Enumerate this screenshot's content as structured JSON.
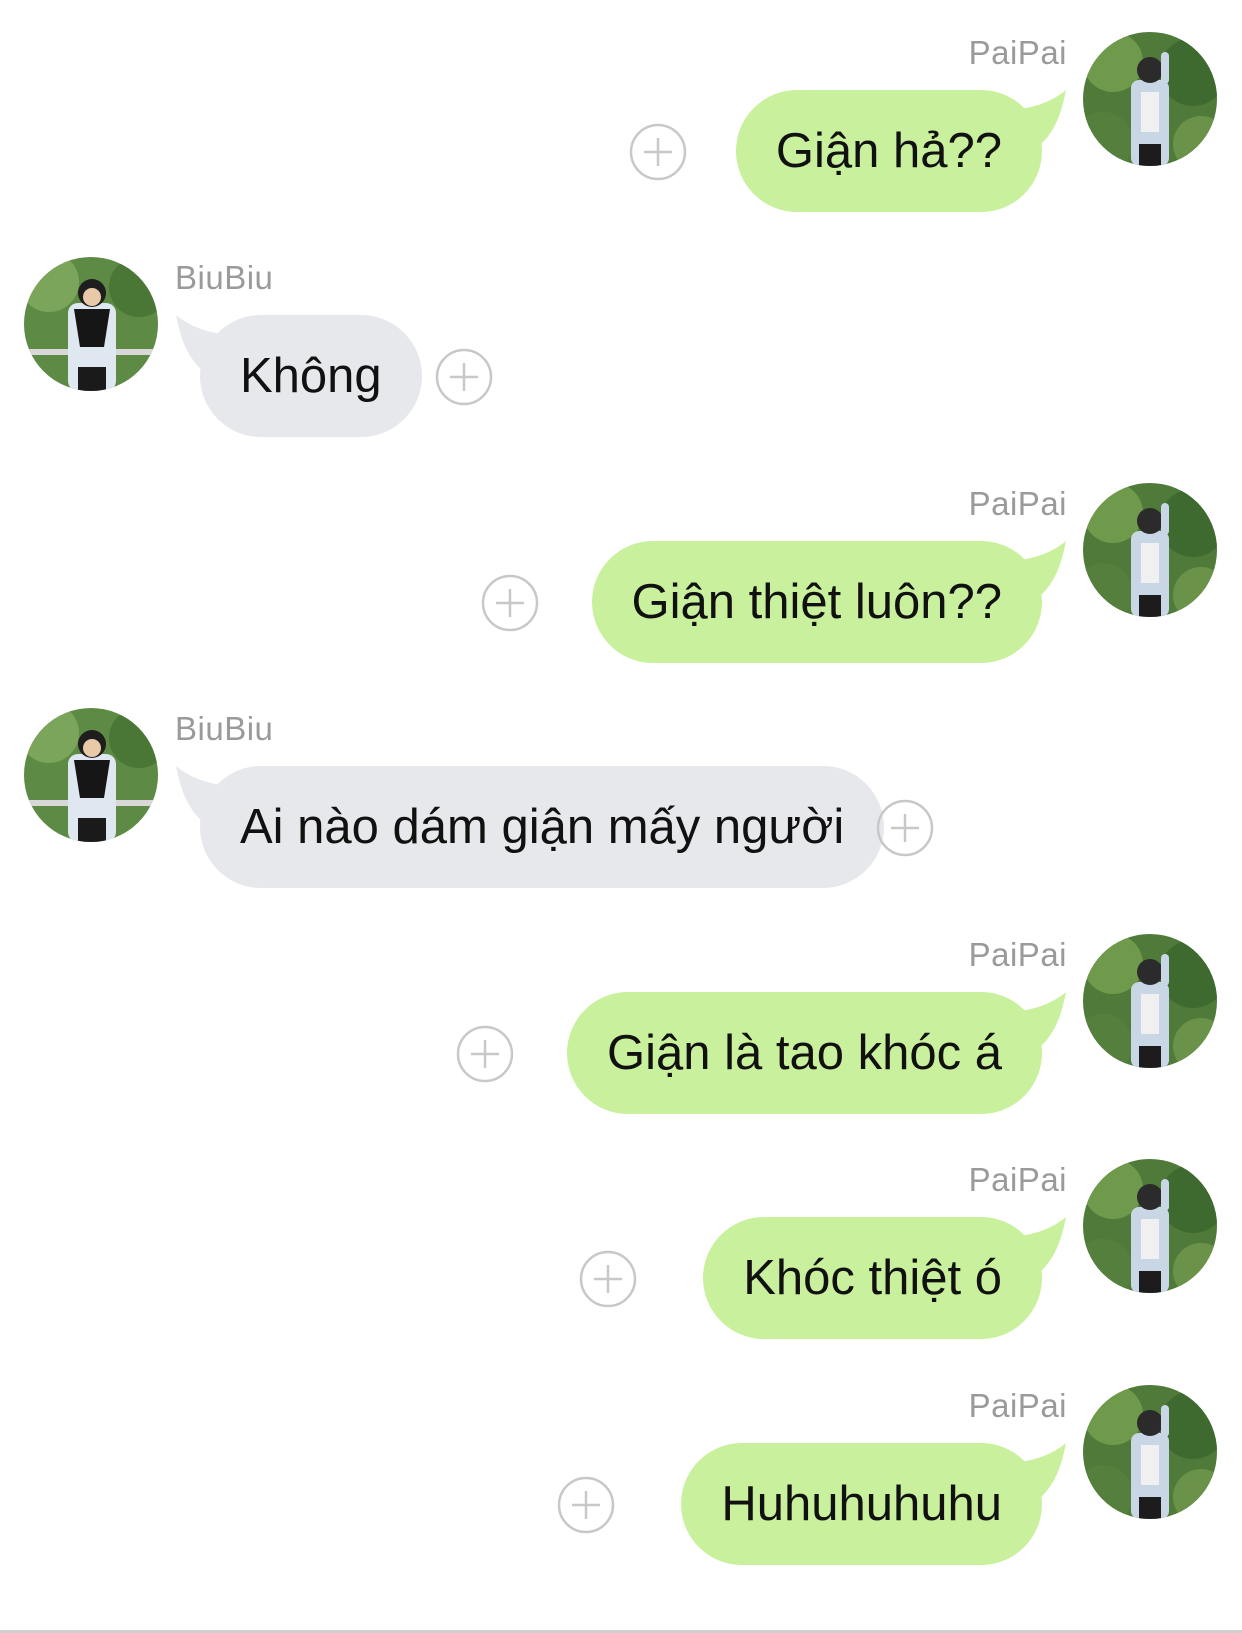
{
  "colors": {
    "sent_bubble": "#c9f09c",
    "received_bubble": "#e6e8eb",
    "sender_name": "#9a9a9a",
    "plus_icon": "#c8c8c8"
  },
  "messages": [
    {
      "sender": "PaiPai",
      "side": "me",
      "text": "Giận hả??"
    },
    {
      "sender": "BiuBiu",
      "side": "them",
      "text": "Không"
    },
    {
      "sender": "PaiPai",
      "side": "me",
      "text": "Giận thiệt luôn??"
    },
    {
      "sender": "BiuBiu",
      "side": "them",
      "text": "Ai nào dám giận mấy người"
    },
    {
      "sender": "PaiPai",
      "side": "me",
      "text": "Giận là tao khóc á"
    },
    {
      "sender": "PaiPai",
      "side": "me",
      "text": "Khóc thiệt ó"
    },
    {
      "sender": "PaiPai",
      "side": "me",
      "text": "Huhuhuhuhu"
    }
  ],
  "icons": {
    "add_reaction": "plus-circle-icon",
    "avatar_me": "avatar-paipai",
    "avatar_them": "avatar-biubiu"
  }
}
